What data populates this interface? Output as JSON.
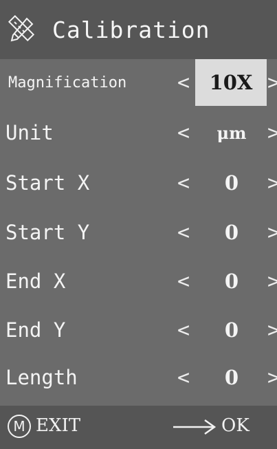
{
  "header": {
    "title": "Calibration",
    "icon": "pencil-ruler-icon"
  },
  "rows": [
    {
      "label": "Magnification",
      "value": "10X",
      "selected": true
    },
    {
      "label": "Unit",
      "value": "μm"
    },
    {
      "label": "Start X",
      "value": "0"
    },
    {
      "label": "Start Y",
      "value": "0"
    },
    {
      "label": "End X",
      "value": "0"
    },
    {
      "label": "End Y",
      "value": "0"
    },
    {
      "label": "Length",
      "value": "0"
    }
  ],
  "arrows": {
    "left": "<",
    "right": ">"
  },
  "footer": {
    "m_icon": "m-circle-icon",
    "exit_label": "EXIT",
    "arrow_icon": "right-arrow-icon",
    "ok_label": "OK"
  },
  "colors": {
    "panel": "#6b6b6b",
    "header": "#565656",
    "selected_bg": "#dcdcdc",
    "text": "#f4f4f4"
  }
}
